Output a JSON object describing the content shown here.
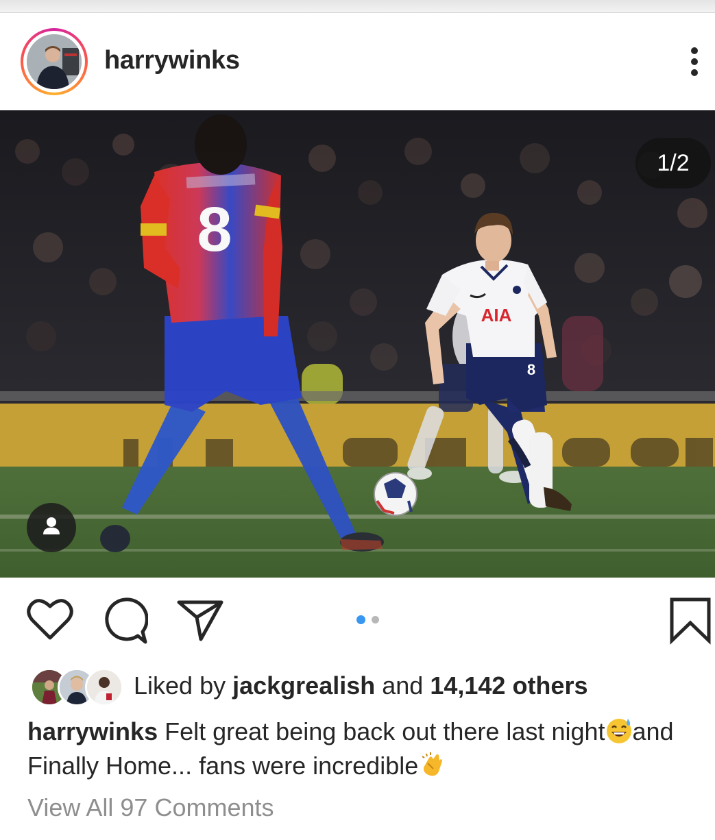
{
  "post": {
    "username": "harrywinks",
    "carousel_counter": "1/2",
    "carousel_position": 1,
    "carousel_total": 2
  },
  "photo": {
    "jersey_number_left": "8",
    "sponsor_text": "AIA",
    "jersey_number_right": "8"
  },
  "likes": {
    "prefix": "Liked by",
    "liker_username": "jackgrealish",
    "connector": "and",
    "others": "14,142 others"
  },
  "caption": {
    "username": "harrywinks",
    "text_part1": "Felt great being back out there last night",
    "emoji1": "sweat-smile-emoji",
    "text_part2": "and Finally Home... fans were incredible",
    "emoji2": "clapping-hands-emoji"
  },
  "comments": {
    "view_all_label": "View All 97 Comments"
  },
  "colors": {
    "accent_blue": "#3897f0",
    "text": "#262626",
    "muted": "#8e8e8e"
  }
}
